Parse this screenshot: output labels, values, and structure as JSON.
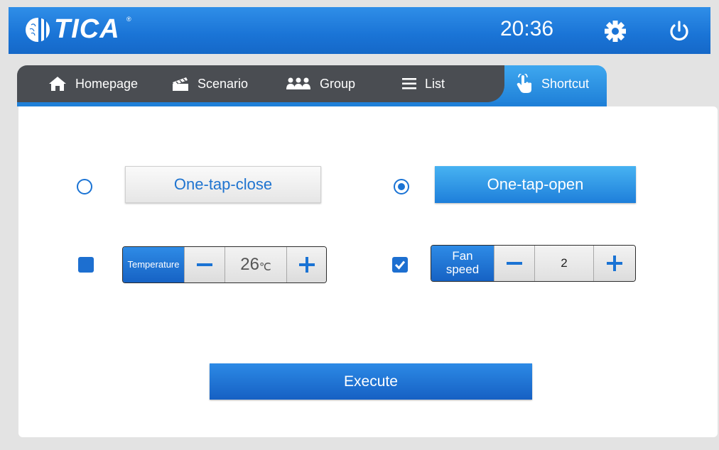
{
  "header": {
    "logo_text": "TICA",
    "logo_mark": "®",
    "time": "20:36",
    "settings_icon": "gear-icon",
    "power_icon": "power-icon"
  },
  "tabs": [
    {
      "label": "Homepage",
      "icon": "home-icon"
    },
    {
      "label": "Scenario",
      "icon": "clapperboard-icon"
    },
    {
      "label": "Group",
      "icon": "group-icon"
    },
    {
      "label": "List",
      "icon": "list-icon"
    },
    {
      "label": "Shortcut",
      "icon": "touch-icon",
      "active": true
    }
  ],
  "shortcut": {
    "close_label": "One-tap-close",
    "open_label": "One-tap-open",
    "selected_mode": "open",
    "temperature": {
      "label": "Temperature",
      "value": "26",
      "unit": "℃",
      "checked": false
    },
    "fan_speed": {
      "label_line1": "Fan",
      "label_line2": "speed",
      "value": "2",
      "checked": true
    },
    "execute_label": "Execute"
  },
  "colors": {
    "accent": "#1a73d4",
    "header": "#1a74d6",
    "tab_bar": "#4a4d52"
  }
}
